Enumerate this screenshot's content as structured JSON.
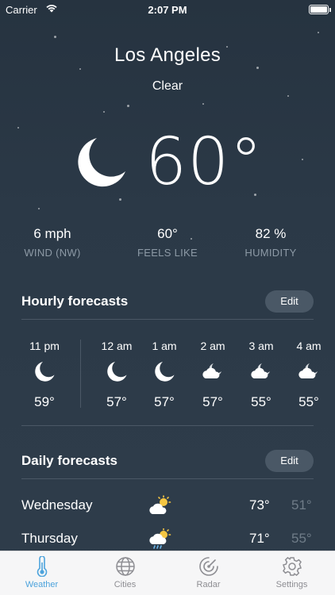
{
  "status_bar": {
    "carrier": "Carrier",
    "time": "2:07 PM"
  },
  "current": {
    "city": "Los Angeles",
    "condition": "Clear",
    "temperature": "60°",
    "icon": "moon-icon",
    "stats": [
      {
        "value": "6 mph",
        "label": "WIND (NW)"
      },
      {
        "value": "60°",
        "label": "FEELS LIKE"
      },
      {
        "value": "82 %",
        "label": "HUMIDITY"
      }
    ]
  },
  "hourly": {
    "title": "Hourly forecasts",
    "edit_label": "Edit",
    "items": [
      {
        "hour": "11 pm",
        "icon": "moon-icon",
        "temp": "59°"
      },
      {
        "hour": "12 am",
        "icon": "moon-icon",
        "temp": "57°"
      },
      {
        "hour": "1 am",
        "icon": "moon-icon",
        "temp": "57°"
      },
      {
        "hour": "2 am",
        "icon": "cloudy-night-icon",
        "temp": "57°"
      },
      {
        "hour": "3 am",
        "icon": "cloudy-night-icon",
        "temp": "55°"
      },
      {
        "hour": "4 am",
        "icon": "cloudy-night-icon",
        "temp": "55°"
      }
    ]
  },
  "daily": {
    "title": "Daily forecasts",
    "edit_label": "Edit",
    "items": [
      {
        "day": "Wednesday",
        "icon": "partly-sunny-icon",
        "high": "73°",
        "low": "51°"
      },
      {
        "day": "Thursday",
        "icon": "sun-rain-icon",
        "high": "71°",
        "low": "55°"
      }
    ]
  },
  "tabs": [
    {
      "label": "Weather",
      "icon": "thermometer-icon",
      "active": true
    },
    {
      "label": "Cities",
      "icon": "globe-icon",
      "active": false
    },
    {
      "label": "Radar",
      "icon": "radar-icon",
      "active": false
    },
    {
      "label": "Settings",
      "icon": "gear-icon",
      "active": false
    }
  ],
  "colors": {
    "accent": "#4da3dc",
    "background": "#2c3a47",
    "muted": "#8d9aa6"
  }
}
